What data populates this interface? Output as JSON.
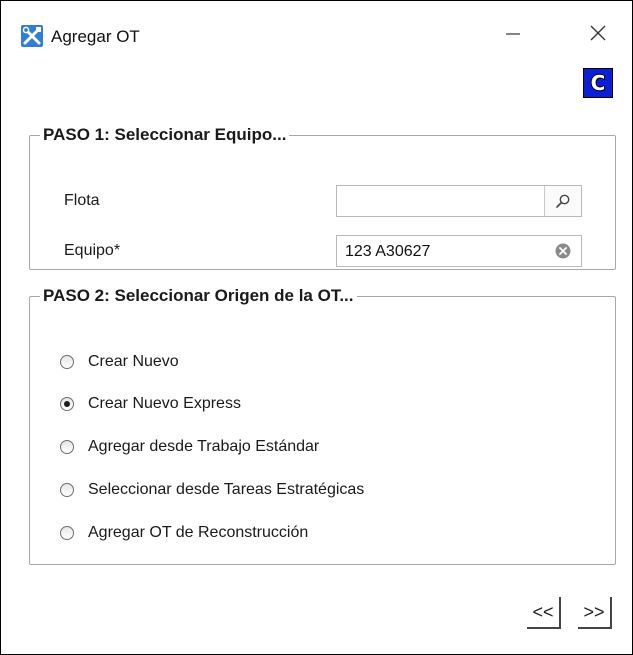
{
  "window": {
    "title": "Agregar OT",
    "minimize_icon": "minimize-icon",
    "close_icon": "close-icon",
    "app_icon": "tools-icon"
  },
  "toolbar": {
    "c_button_label": "C",
    "accent_color": "#0b1fd6"
  },
  "step1": {
    "title": "PASO 1: Seleccionar Equipo...",
    "flota": {
      "label": "Flota",
      "value": "",
      "icon": "search-icon"
    },
    "equipo": {
      "label": "Equipo*",
      "value": "123 A30627",
      "icon": "clear-icon"
    }
  },
  "step2": {
    "title": "PASO 2: Seleccionar Origen de la OT...",
    "options": [
      {
        "label": "Crear Nuevo",
        "checked": false
      },
      {
        "label": "Crear Nuevo Express",
        "checked": true
      },
      {
        "label": "Agregar desde Trabajo Estándar",
        "checked": false
      },
      {
        "label": "Seleccionar desde Tareas Estratégicas",
        "checked": false
      },
      {
        "label": "Agregar OT de Reconstrucción",
        "checked": false
      }
    ]
  },
  "nav": {
    "prev_label": "<<",
    "next_label": ">>"
  }
}
